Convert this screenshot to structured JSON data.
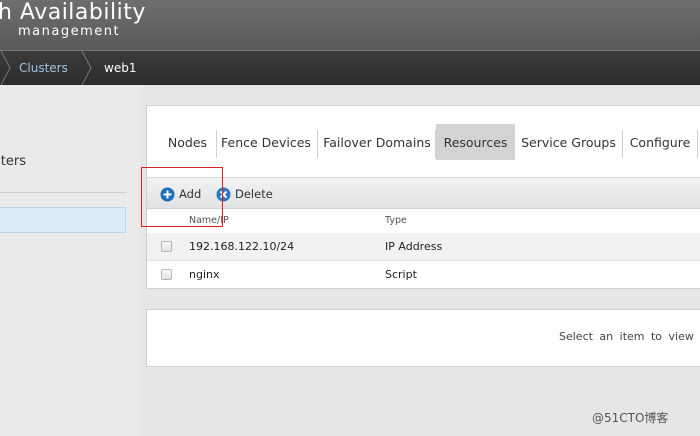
{
  "header": {
    "title": "h Availability",
    "subtitle": "management"
  },
  "breadcrumb": {
    "items": [
      "Clusters",
      "web1"
    ]
  },
  "sidebar": {
    "label": "sters"
  },
  "tabs": [
    {
      "label": "Nodes",
      "active": false
    },
    {
      "label": "Fence Devices",
      "active": false
    },
    {
      "label": "Failover Domains",
      "active": false
    },
    {
      "label": "Resources",
      "active": true
    },
    {
      "label": "Service Groups",
      "active": false
    },
    {
      "label": "Configure",
      "active": false
    }
  ],
  "toolbar": {
    "add_label": "Add",
    "delete_label": "Delete"
  },
  "table": {
    "columns": [
      "Name/IP",
      "Type"
    ],
    "rows": [
      {
        "name": "192.168.122.10/24",
        "type": "IP Address"
      },
      {
        "name": "nginx",
        "type": "Script"
      }
    ]
  },
  "detail": {
    "message": "Select an item to view deta"
  },
  "watermark": "@51CTO博客",
  "colors": {
    "add_icon": "#1e6fb8",
    "delete_icon": "#2a78c2",
    "highlight": "#dd2222",
    "active_tab": "#d3d3d3"
  }
}
